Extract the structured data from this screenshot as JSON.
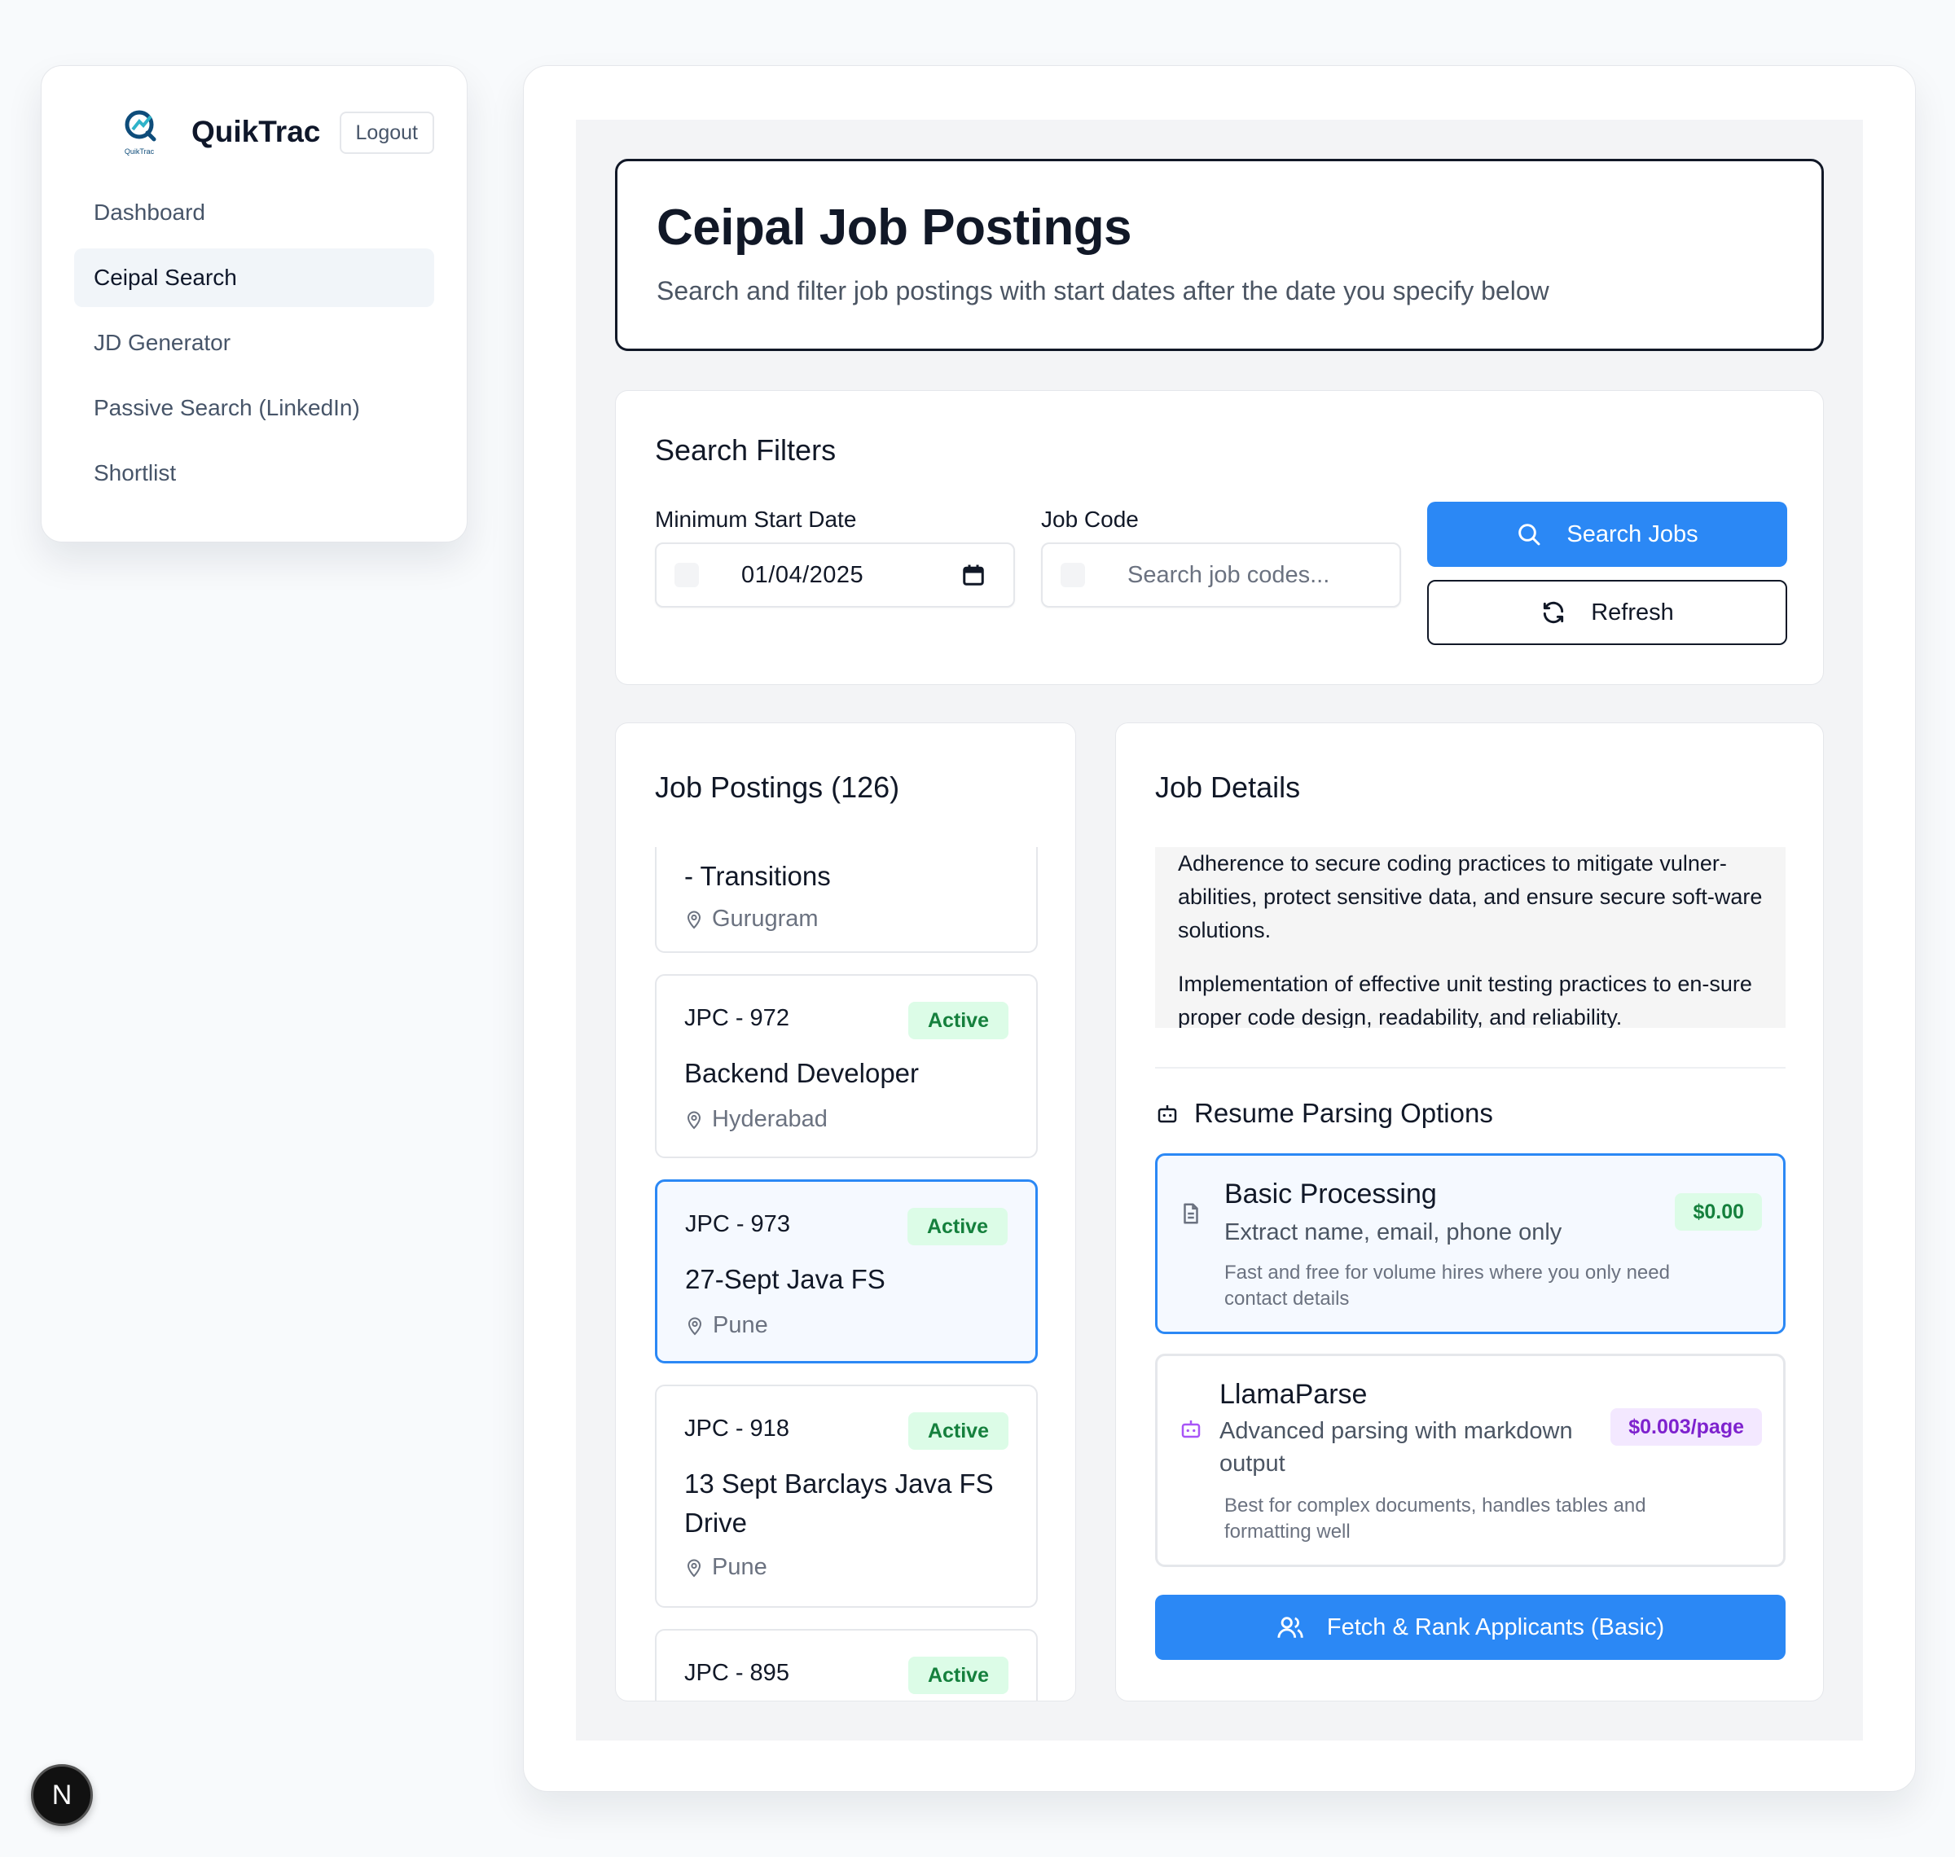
{
  "app": {
    "name": "QuikTrac",
    "logo_text": "QuikTrac",
    "logout_label": "Logout"
  },
  "sidebar": {
    "items": [
      {
        "label": "Dashboard",
        "active": false
      },
      {
        "label": "Ceipal Search",
        "active": true
      },
      {
        "label": "JD Generator",
        "active": false
      },
      {
        "label": "Passive Search (LinkedIn)",
        "active": false
      },
      {
        "label": "Shortlist",
        "active": false
      }
    ]
  },
  "header": {
    "title": "Ceipal Job Postings",
    "subtitle": "Search and filter job postings with start dates after the date you specify below"
  },
  "filters": {
    "title": "Search Filters",
    "min_date_label": "Minimum Start Date",
    "min_date_value": "01/04/2025",
    "job_code_label": "Job Code",
    "job_code_placeholder": "Search job codes...",
    "job_code_value": "",
    "search_label": "Search Jobs",
    "refresh_label": "Refresh"
  },
  "postings": {
    "title": "Job Postings (126)",
    "items": [
      {
        "code": "",
        "status": "",
        "title": "- Transitions",
        "location": "Gurugram"
      },
      {
        "code": "JPC - 972",
        "status": "Active",
        "title": "Backend Developer",
        "location": "Hyderabad"
      },
      {
        "code": "JPC - 973",
        "status": "Active",
        "title": "27-Sept Java FS",
        "location": "Pune",
        "selected": true
      },
      {
        "code": "JPC - 918",
        "status": "Active",
        "title": "13 Sept Barclays Java FS Drive",
        "location": "Pune"
      },
      {
        "code": "JPC - 895",
        "status": "Active",
        "title": "",
        "location": ""
      }
    ]
  },
  "details": {
    "title": "Job Details",
    "paragraphs": [
      "Adherence to secure coding practices to mitigate vulner-abilities, protect sensitive data, and ensure secure soft-ware solutions.",
      "Implementation of effective unit testing practices to en-sure proper code design, readability, and reliability."
    ],
    "parsing_title": "Resume Parsing Options",
    "options": [
      {
        "name": "Basic Processing",
        "description": "Extract name, email, phone only",
        "note": "Fast and free for volume hires where you only need contact details",
        "price": "$0.00",
        "selected": true
      },
      {
        "name": "LlamaParse",
        "description": "Advanced parsing with markdown output",
        "note": "Best for complex documents, handles tables and formatting well",
        "price": "$0.003/page",
        "selected": false
      }
    ],
    "fetch_label": "Fetch & Rank Applicants (Basic)"
  },
  "dev_badge": "N",
  "colors": {
    "primary": "#2b88f5",
    "active_badge_bg": "#dcfce7",
    "active_badge_text": "#15803d",
    "price_purple_bg": "#f3e8ff",
    "price_purple_text": "#7e22ce"
  }
}
